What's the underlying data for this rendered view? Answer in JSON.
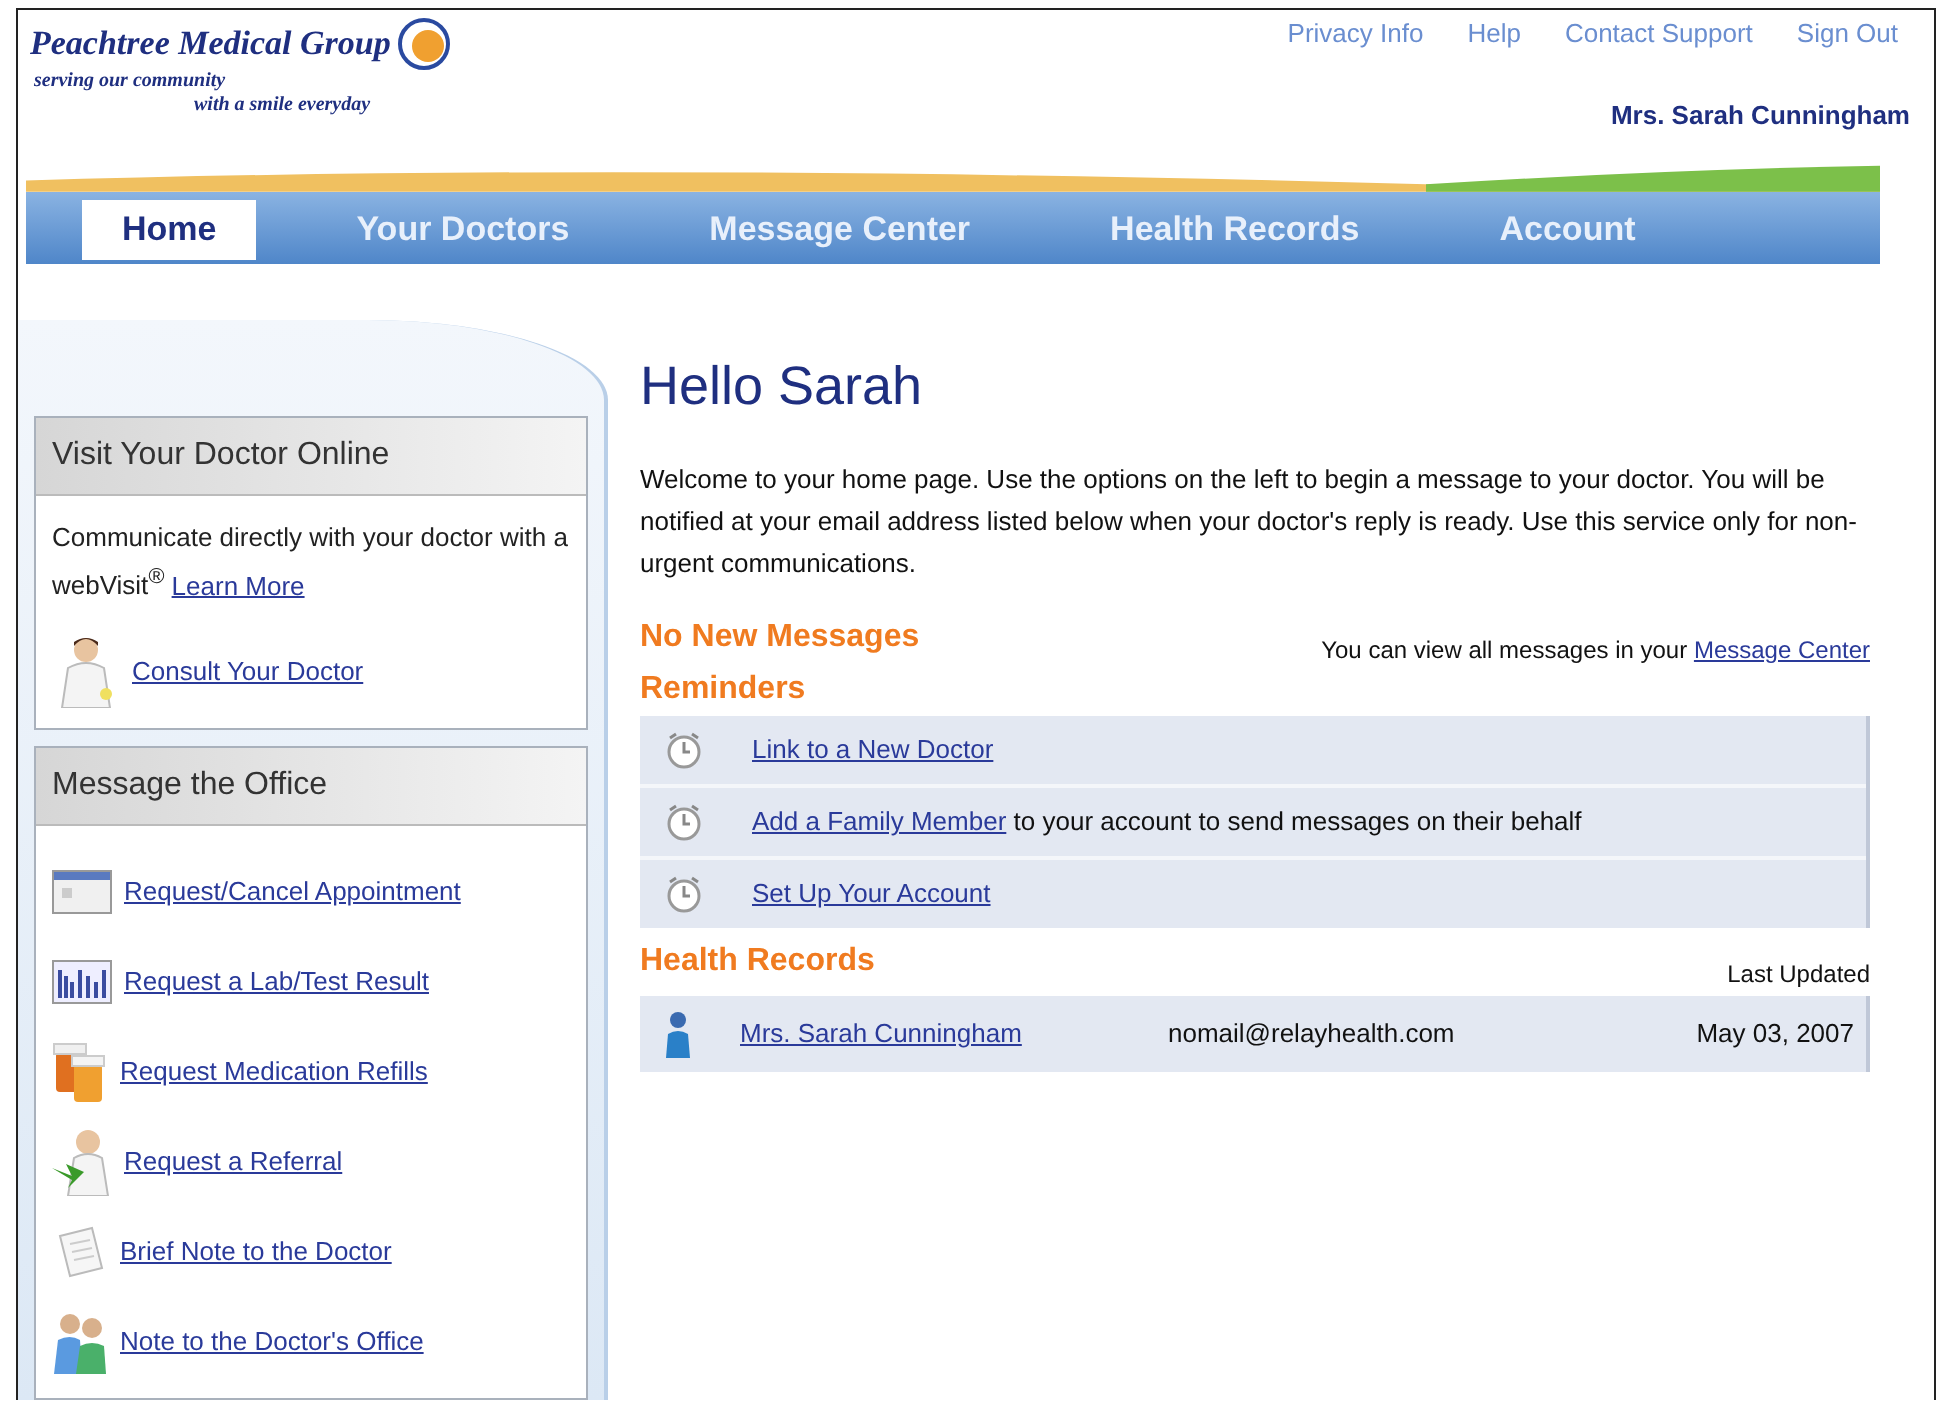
{
  "logo": {
    "name": "Peachtree Medical Group",
    "tagline_1": "serving our community",
    "tagline_2": "with a smile everyday"
  },
  "top_links": [
    "Privacy Info",
    "Help",
    "Contact Support",
    "Sign Out"
  ],
  "user_name": "Mrs. Sarah Cunningham",
  "tabs": [
    {
      "label": "Home",
      "selected": true
    },
    {
      "label": "Your Doctors",
      "selected": false
    },
    {
      "label": "Message Center",
      "selected": false
    },
    {
      "label": "Health Records",
      "selected": false
    },
    {
      "label": "Account",
      "selected": false
    }
  ],
  "sidebar": {
    "panels": [
      {
        "title": "Visit Your Doctor Online",
        "intro": "Communicate directly with your doctor with a webVisit$^{®}$",
        "intro_link": "Learn More",
        "items": [
          {
            "label": "Consult Your Doctor",
            "kind": "doctor"
          }
        ]
      },
      {
        "title": "Message the Office",
        "items": [
          {
            "label": "Request/Cancel Appointment",
            "kind": "calendar"
          },
          {
            "label": "Request a Lab/Test Result",
            "kind": "chart"
          },
          {
            "label": "Request Medication Refills",
            "kind": "pills"
          },
          {
            "label": "Request a Referral",
            "kind": "referral"
          },
          {
            "label": "Brief Note to the Doctor",
            "kind": "note"
          },
          {
            "label": "Note to the Doctor's Office",
            "kind": "people"
          }
        ]
      }
    ]
  },
  "greeting": "Hello Sarah",
  "welcome": "Welcome to your home page. Use the options on the left to begin a message to your doctor. You will be notified at your email address listed below when your doctor's reply is ready. Use this service only for non-urgent communications.",
  "messages": {
    "heading": "No New Messages",
    "note": "You can view all messages in your",
    "note_link": "Message Center"
  },
  "reminders": {
    "heading": "Reminders",
    "items": [
      {
        "link": "Link to a New Doctor"
      },
      {
        "link": "Add a Family Member",
        "text": "to your account to send messages on their behalf"
      },
      {
        "link": "Set Up Your Account"
      }
    ]
  },
  "health_records": {
    "heading": "Health Records",
    "column_label": "Last Updated",
    "rows": [
      {
        "name": "Mrs. Sarah Cunningham",
        "email": "nomail@relayhealth.com",
        "date": "May 03, 2007"
      }
    ]
  }
}
